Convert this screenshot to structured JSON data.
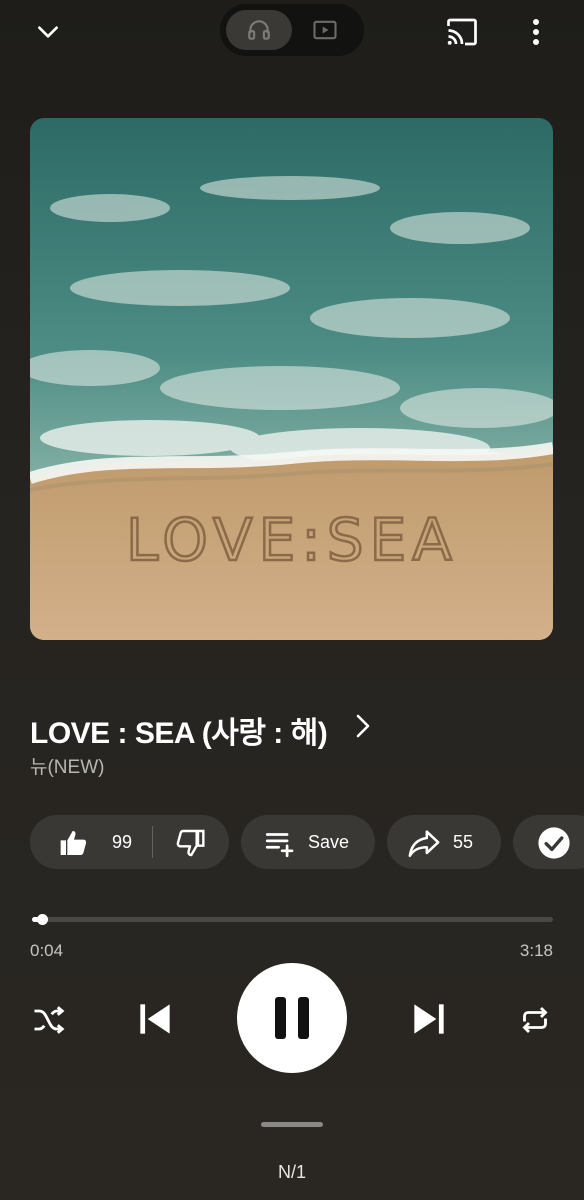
{
  "topbar": {
    "collapse_icon": "chevron-down-icon",
    "audio_icon": "headphones-icon",
    "video_icon": "video-icon",
    "cast_icon": "cast-icon",
    "more_icon": "more-vert-icon",
    "active_mode": "audio"
  },
  "album_art": {
    "text": "LOVE:SEA",
    "colors": {
      "sea": "#3f7f79",
      "foam": "#e9efe9",
      "sand": "#c9a57a"
    }
  },
  "song": {
    "title": "LOVE : SEA (사랑 : 해)",
    "artist": "뉴(NEW)"
  },
  "actions": {
    "like_count": "99",
    "save_label": "Save",
    "share_count": "55"
  },
  "progress": {
    "current": "0:04",
    "duration": "3:18",
    "fraction": 0.02
  },
  "controls": {
    "shuffle_icon": "shuffle-icon",
    "previous_icon": "skip-previous-icon",
    "play_state": "playing",
    "next_icon": "skip-next-icon",
    "repeat_icon": "repeat-icon"
  },
  "queue": {
    "label": "N/1"
  }
}
